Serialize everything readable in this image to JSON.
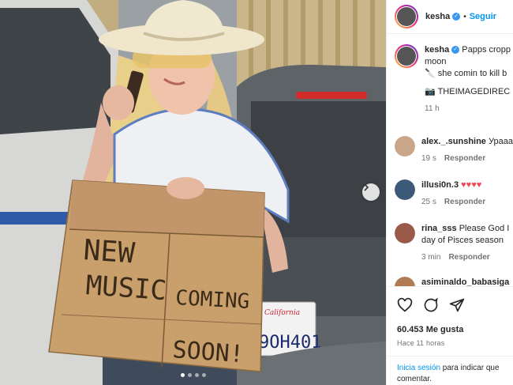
{
  "post": {
    "username": "kesha",
    "separator": "•",
    "follow_label": "Seguir"
  },
  "photo": {
    "sign_lines": [
      "NEW",
      "MUSIC",
      "COMING",
      "SOON!"
    ],
    "plate_text": "9OH401",
    "plate_state": "California",
    "slide_count": 4,
    "active_slide": 1
  },
  "caption": {
    "username": "kesha",
    "line1": "Papps cropp",
    "line2": "moon",
    "line3": "she comin to kill b",
    "line4": "THEIMAGEDIREC",
    "time": "11 h"
  },
  "comments": [
    {
      "user": "alex._.sunshine",
      "text": "Урааа",
      "time": "19 s",
      "reply": "Responder"
    },
    {
      "user": "illusi0n.3",
      "text": "♥♥♥♥",
      "time": "25 s",
      "reply": "Responder"
    },
    {
      "user": "rina_sss",
      "text": "Please God I",
      "text2": "day of Pisces season",
      "time": "3 min",
      "reply": "Responder"
    },
    {
      "user": "asiminaldo_babasiga",
      "text": "",
      "time": "",
      "reply": ""
    }
  ],
  "actions": {
    "likes": "60.453 Me gusta",
    "posted": "Hace 11 horas"
  },
  "login": {
    "link": "Inicia sesión",
    "text": " para indicar que",
    "text2": "comentar."
  }
}
